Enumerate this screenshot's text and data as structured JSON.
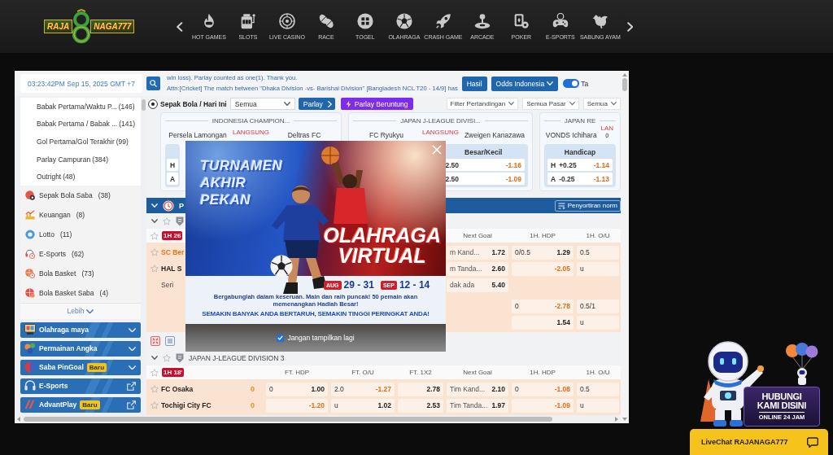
{
  "header": {
    "logo": {
      "left": "RAJA",
      "right": "NAGA777"
    },
    "menu": [
      "HOT GAMES",
      "SLOTS",
      "LIVE CASINO",
      "RACE",
      "TOGEL",
      "OLAHRAGA",
      "CRASH GAME",
      "ARCADE",
      "POKER",
      "E-SPORTS",
      "SABUNG AYAM"
    ]
  },
  "sportsbook": {
    "clock": "03:23:42PM Sep 15, 2025 GMT +7",
    "announcements": [
      "win loss). Parlay counted as one(1). Thank you.",
      "Attn:[Cricket] The match between \"Dhaka Division -vs- Barishal Division\" [Bangladesh NCL T20 - 14/9] has"
    ],
    "results_button": "Hasil",
    "odds_format": "Odds Indonesia",
    "toggle": {
      "on": true,
      "label": "Ta"
    },
    "sidebar": {
      "submenu": [
        {
          "label": "Babak Pertama/Waktu P...",
          "count": "(146)"
        },
        {
          "label": "Babak Pertama / Babak ...",
          "count": "(141)"
        },
        {
          "label": "Gol Pertama/Gol Terakhir",
          "count": "(99)"
        },
        {
          "label": "Parlay Campuran",
          "count": "(384)"
        },
        {
          "label": "Outright",
          "count": "(48)"
        }
      ],
      "sports": [
        {
          "label": "Sepak Bola Saba",
          "count": "(38)"
        },
        {
          "label": "Keuangan",
          "count": "(8)"
        },
        {
          "label": "Lotto",
          "count": "(11)"
        },
        {
          "label": "E-Sports",
          "count": "(62)"
        },
        {
          "label": "Bola Basket",
          "count": "(73)"
        },
        {
          "label": "Bola Basket Saba",
          "count": "(4)"
        }
      ],
      "more": "Lebih",
      "sections": [
        {
          "label": "Olahraga maya",
          "kind": "expand"
        },
        {
          "label": "Permainan Angka",
          "kind": "expand"
        },
        {
          "label": "Saba PinGoal",
          "badge": "Baru",
          "kind": "expand"
        },
        {
          "label": "E-Sports",
          "kind": "external"
        },
        {
          "label": "AdvantPlay",
          "badge": "Baru",
          "kind": "external"
        }
      ]
    },
    "toolbar": {
      "title": "Sepak Bola / Hari Ini",
      "period": "Semua",
      "parlay": "Parlay",
      "lucky_parlay": "Parlay Beruntung",
      "filters": [
        "Filter Pertandingan",
        "Semua Pasar",
        "Semua"
      ]
    },
    "featured": [
      {
        "league": "INDONESIA CHAMPION...",
        "home": "Persela Lamongan",
        "status": "LANGSUNG",
        "away": "Deltras FC",
        "handicap": {
          "rows": [
            {
              "side": "H"
            },
            {
              "side": "A"
            }
          ]
        }
      },
      {
        "league": "JAPAN J-LEAGUE DIVISI...",
        "home": "FC Ryukyu",
        "status": "LANGSUNG",
        "away": "Zweigen Kanazawa",
        "over_under": {
          "name": "Besar/Kecil",
          "rows": [
            {
              "line": "2.50",
              "odds": "-1.16",
              "negative": true
            },
            {
              "line": "2.50",
              "odds": "-1.09",
              "negative": true
            }
          ]
        }
      },
      {
        "league": "JAPAN RE",
        "home": "VONDS Ichihara",
        "status": "LAN",
        "time": "0",
        "handicap": {
          "name": "Handicap",
          "rows": [
            {
              "side": "H",
              "line": "+0.25",
              "odds": "-1.14",
              "negative": true
            },
            {
              "side": "A",
              "line": "-0.25",
              "odds": "-1.13",
              "negative": true
            }
          ]
        }
      }
    ],
    "section_bar": {
      "title": "P",
      "sort": "Penyortiran norm"
    },
    "groups": [
      {
        "expanded": true,
        "headers": {
          "live": "1H 26",
          "next_goal": "Next Goal",
          "h1_hdp": "1H. HDP",
          "h1_ou": "1H. O/U"
        },
        "rows": [
          {
            "kind": "team",
            "team": "SC Ber",
            "favorite": true,
            "cells": {
              "next_goal": {
                "pick": "m Kand...",
                "odds": "1.72",
                "negative": false
              },
              "h1_hdp": {
                "line": "0/0.5",
                "odds": "1.29",
                "negative": false
              },
              "h1_ou": {
                "line": "0.5"
              }
            }
          },
          {
            "kind": "team",
            "team": "HAL S",
            "favorite": false,
            "cells": {
              "next_goal": {
                "pick": "m Tanda...",
                "odds": "2.60",
                "negative": false
              },
              "h1_hdp": {
                "odds": "-2.05",
                "negative": true
              },
              "h1_ou": {
                "line": "u"
              }
            }
          },
          {
            "kind": "draw",
            "team": "Seri",
            "cells": {
              "next_goal": {
                "pick": "dak ada",
                "odds": "5.40",
                "negative": false
              }
            }
          },
          {
            "kind": "line",
            "cells": {
              "h1_hdp": {
                "line": "0",
                "odds": "-2.78",
                "negative": true
              },
              "h1_ou": {
                "line": "0.5/1"
              }
            }
          },
          {
            "kind": "line",
            "cells": {
              "h1_hdp": {
                "odds": "1.54",
                "negative": false
              },
              "h1_ou": {
                "line": "u"
              }
            }
          }
        ]
      },
      {
        "expanded": true,
        "league": "JAPAN J-LEAGUE DIVISION 3",
        "headers": {
          "live": "1H 18'",
          "ft_hdp": "FT. HDP",
          "ft_ou": "FT. O/U",
          "ft_1x2": "FT. 1X2",
          "next_goal": "Next Goal",
          "h1_hdp": "1H. HDP",
          "h1_ou": "1H. O/U"
        },
        "rows": [
          {
            "kind": "team",
            "team": "FC Osaka",
            "favorite": false,
            "score": "0",
            "cells": {
              "ft_hdp": {
                "line": "0",
                "odds": "1.00",
                "negative": false
              },
              "ft_ou": {
                "line": "2.0",
                "odds": "-1.27",
                "negative": true
              },
              "ft_1x2": {
                "odds": "2.78",
                "negative": false
              },
              "next_goal": {
                "pick": "Tim Kand...",
                "odds": "2.10",
                "negative": false
              },
              "h1_hdp": {
                "line": "0",
                "odds": "-1.08",
                "negative": true
              },
              "h1_ou": {
                "line": "0.5"
              }
            }
          },
          {
            "kind": "team",
            "team": "Tochigi City FC",
            "favorite": false,
            "score": "0",
            "cells": {
              "ft_hdp": {
                "odds": "-1.20",
                "negative": true
              },
              "ft_ou": {
                "line": "u",
                "odds": "1.02",
                "negative": false
              },
              "ft_1x2": {
                "odds": "2.53",
                "negative": false
              },
              "next_goal": {
                "pick": "Tim Tanda...",
                "odds": "1.97",
                "negative": false
              },
              "h1_hdp": {
                "odds": "-1.09",
                "negative": true
              },
              "h1_ou": {
                "line": "u"
              }
            }
          }
        ]
      }
    ]
  },
  "promo_popup": {
    "title": [
      "TURNAMEN",
      "AKHIR",
      "PEKAN"
    ],
    "headline": [
      "OLAHRAGA",
      "VIRTUAL"
    ],
    "dates": [
      {
        "month": "AUG",
        "days": "29 - 31"
      },
      {
        "month": "SEP",
        "days": "12 - 14"
      }
    ],
    "note": "Bergabunglah dalam keseruan. Main dan raih puncak! 50 pemain akan memenangkan Hadiah Besar!",
    "tagline": "SEMAKIN BANYAK ANDA BERTARUH, SEMAKIN TINGGI PERINGKAT ANDA!",
    "dont_show": {
      "label": "Jangan tampilkan lagi",
      "checked": true
    }
  },
  "live_chat": {
    "heading": [
      "HUBUNGI",
      "KAMI DISINI"
    ],
    "hours": "ONLINE 24 JAM",
    "button": "LiveChat RAJANAGA777"
  }
}
